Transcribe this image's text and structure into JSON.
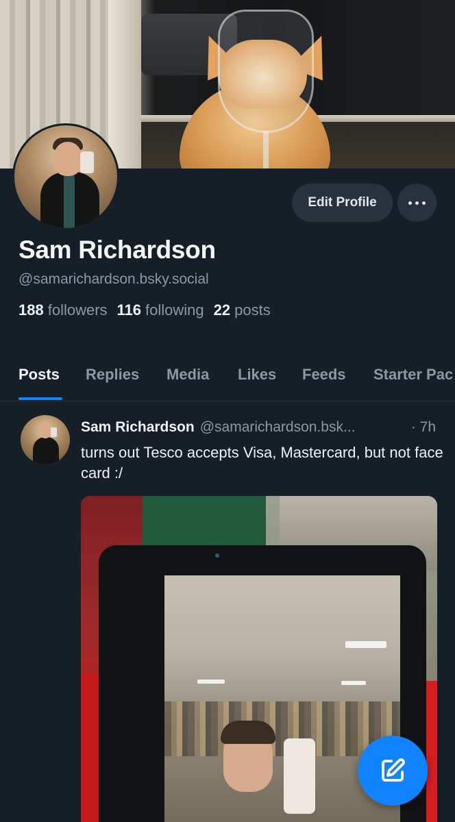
{
  "profile": {
    "display_name": "Sam Richardson",
    "handle": "@samarichardson.bsky.social",
    "followers_count": "188",
    "followers_label": "followers",
    "following_count": "116",
    "following_label": "following",
    "posts_count": "22",
    "posts_label": "posts"
  },
  "actions": {
    "edit_profile_label": "Edit Profile",
    "more_icon": "ellipsis-icon"
  },
  "tabs": [
    {
      "label": "Posts",
      "active": true
    },
    {
      "label": "Replies",
      "active": false
    },
    {
      "label": "Media",
      "active": false
    },
    {
      "label": "Likes",
      "active": false
    },
    {
      "label": "Feeds",
      "active": false
    },
    {
      "label": "Starter Pac",
      "active": false
    }
  ],
  "post": {
    "author": "Sam Richardson",
    "handle": "@samarichardson.bsk...",
    "time": "· 7h",
    "text": "turns out Tesco accepts Visa, Mastercard, but not face card :/"
  },
  "fab": {
    "icon": "compose-icon"
  },
  "colors": {
    "background": "#161e27",
    "accent": "#1083fe",
    "button_bg": "#28313d",
    "muted_text": "#8c98a6"
  }
}
